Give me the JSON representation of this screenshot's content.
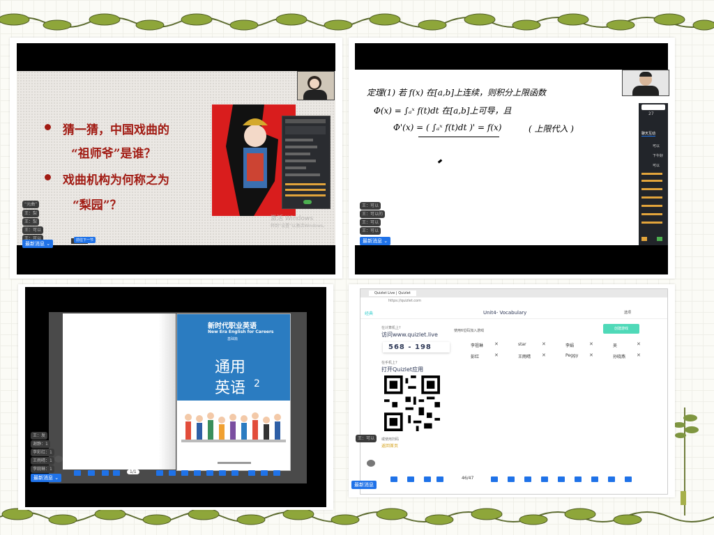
{
  "panel1": {
    "bullet1_line1": "猜一猜，中国戏曲的",
    "bullet1_line2": "“祖师爷”是谁？",
    "bullet2_line1": "戏曲机构为何称之为",
    "bullet2_line2": "“梨园”？",
    "watermark1": "激活 Windows",
    "watermark2": "转到“设置”以激活Windows。",
    "chat": [
      "“元曲”",
      "王：梨",
      "王：梨",
      "王：可以",
      "王：可以"
    ],
    "new_msg": "最新消息 ⌄",
    "blue_btn": "前往下一节"
  },
  "panel2": {
    "line1": "定理(1) 若 f(x) 在[a,b]上连续，则积分上限函数",
    "line2": "Φ(x) = ∫ₐˣ f(t)dt 在[a,b]上可导，且",
    "line3": "Φ'(x) = ( ∫ₐˣ f(t)dt )' = f(x)",
    "line3_note": "( 上限代入 )",
    "chat": [
      "王：可以",
      "王：可以的",
      "王：可以",
      "王：可以"
    ],
    "new_msg": "最新消息 ⌄",
    "side_tab": "聊天互动",
    "side_count": "27",
    "side_items": [
      "可以",
      "下午好",
      "可以",
      "可以",
      "可以"
    ]
  },
  "panel3": {
    "book_title_cn": "新时代职业英语",
    "book_title_en": "New Era English for Careers",
    "book_sub": "基础篇",
    "book_main1": "通用",
    "book_main2": "英语",
    "book_num": "2",
    "chat": [
      "王：发",
      "谢静：1",
      "李彩红：1",
      "王雨晴：1",
      "李婉琳：1"
    ],
    "new_msg": "最新消息 ⌄",
    "page_indicator": "1/1"
  },
  "panel4": {
    "tab_title": "Quizlet Live | Quizlet",
    "url": "https://quizlet.com",
    "logo": "经典",
    "set_title": "Unit4- Vocabulary",
    "help_q1": "在计算机上?",
    "visit": "访问www.quizlet.live",
    "code": "568 - 198",
    "help_q2": "在手机上?",
    "open_app": "打开Quizlet应用",
    "bottom_hint": "或使用扫码",
    "bottom_link": "返回首页",
    "join_prompt": "使用6位码加入游戏",
    "start_btn": "创建游戏",
    "players_row1": [
      "李祖琳",
      "star",
      "李娟",
      "吴"
    ],
    "players_row2": [
      "彭红",
      "王雨晴",
      "Peggy",
      "孙晓燕"
    ],
    "header_btn": "选项",
    "chat": [
      "王：可以"
    ],
    "new_msg": "最新消息",
    "page_indicator": "46/47"
  }
}
